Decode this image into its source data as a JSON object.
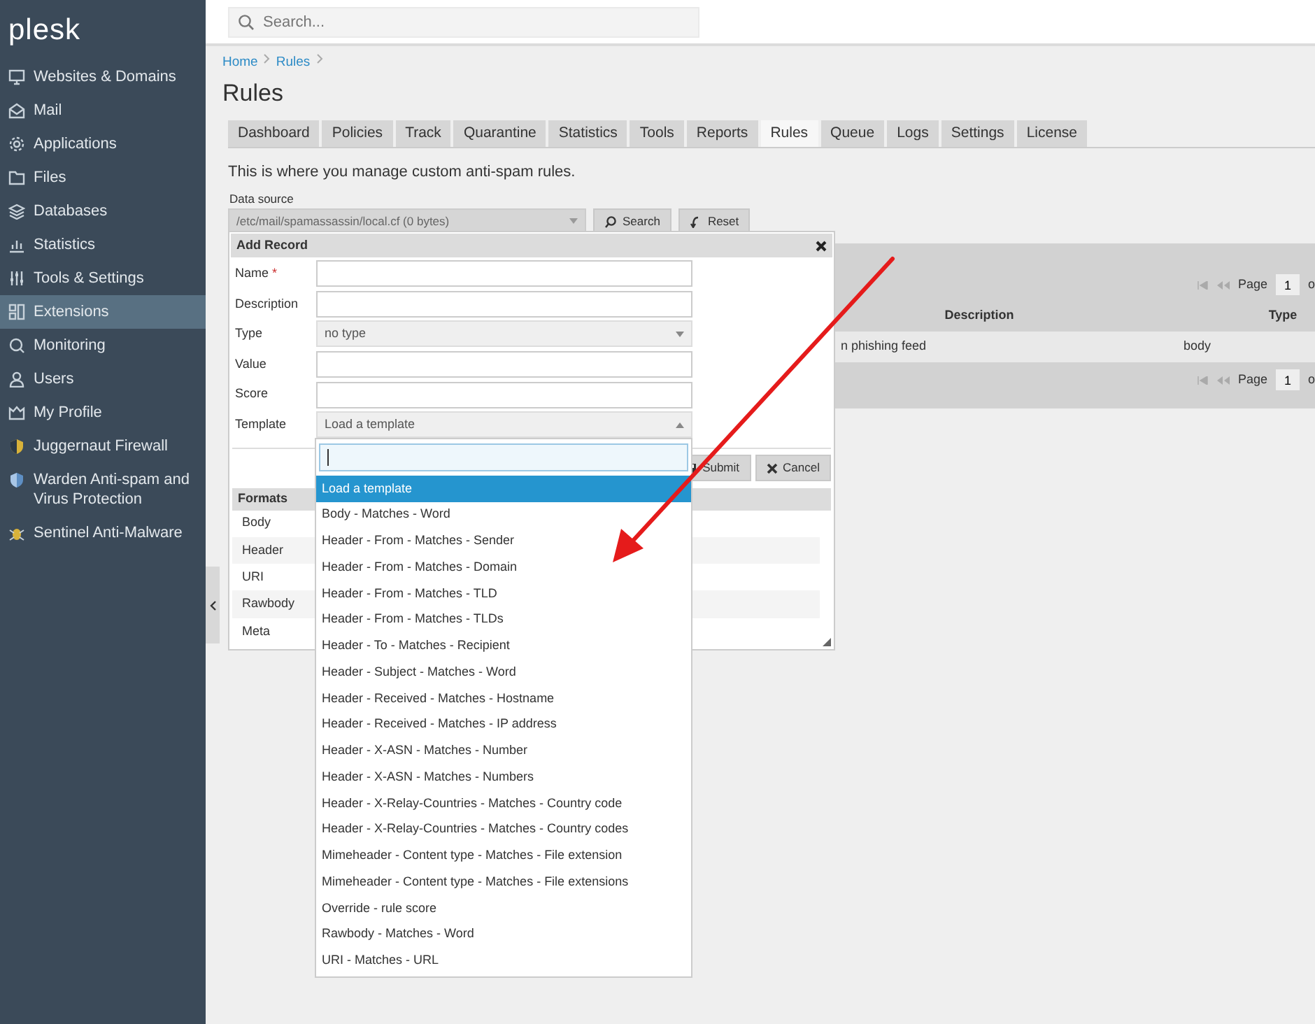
{
  "logo": "plesk",
  "sidebar": {
    "items": [
      {
        "label": "Websites & Domains",
        "selected": false
      },
      {
        "label": "Mail",
        "selected": false
      },
      {
        "label": "Applications",
        "selected": false
      },
      {
        "label": "Files",
        "selected": false
      },
      {
        "label": "Databases",
        "selected": false
      },
      {
        "label": "Statistics",
        "selected": false
      },
      {
        "label": "Tools & Settings",
        "selected": false
      },
      {
        "label": "Extensions",
        "selected": true
      },
      {
        "label": "Monitoring",
        "selected": false
      },
      {
        "label": "Users",
        "selected": false
      },
      {
        "label": "My Profile",
        "selected": false
      },
      {
        "label": "Juggernaut Firewall",
        "selected": false
      },
      {
        "label": "Warden Anti-spam and Virus Protection",
        "selected": false
      },
      {
        "label": "Sentinel Anti-Malware",
        "selected": false
      }
    ]
  },
  "search": {
    "placeholder": "Search..."
  },
  "breadcrumbs": [
    "Home",
    "Rules"
  ],
  "page_title": "Rules",
  "tabs": [
    {
      "label": "Dashboard",
      "selected": false
    },
    {
      "label": "Policies",
      "selected": false
    },
    {
      "label": "Track",
      "selected": false
    },
    {
      "label": "Quarantine",
      "selected": false
    },
    {
      "label": "Statistics",
      "selected": false
    },
    {
      "label": "Tools",
      "selected": false
    },
    {
      "label": "Reports",
      "selected": false
    },
    {
      "label": "Rules",
      "selected": true
    },
    {
      "label": "Queue",
      "selected": false
    },
    {
      "label": "Logs",
      "selected": false
    },
    {
      "label": "Settings",
      "selected": false
    },
    {
      "label": "License",
      "selected": false
    }
  ],
  "intro": "This is where you manage custom anti-spam rules.",
  "data_source": {
    "label": "Data source",
    "value": "/etc/mail/spamassassin/local.cf (0 bytes)"
  },
  "buttons": [
    "Search",
    "Reset"
  ],
  "table": {
    "pagers": [
      {
        "label": "Page",
        "page": "1",
        "suffix": "o"
      },
      {
        "label": "Page",
        "page": "1",
        "suffix": "o"
      }
    ],
    "columns": [
      "Description",
      "Type"
    ],
    "rows": [
      {
        "description": "n phishing feed",
        "type": "body"
      }
    ]
  },
  "dialog": {
    "title": "Add Record",
    "fields": [
      {
        "label": "Name",
        "required_mark": "*",
        "kind": "text"
      },
      {
        "label": "Description",
        "kind": "text"
      },
      {
        "label": "Type",
        "kind": "select",
        "value": "no type",
        "expanded": false
      },
      {
        "label": "Value",
        "kind": "text"
      },
      {
        "label": "Score",
        "kind": "text"
      },
      {
        "label": "Template",
        "kind": "select",
        "value": "Load a template",
        "expanded": true
      }
    ],
    "buttons": [
      "Submit",
      "Cancel"
    ],
    "formats": {
      "title": "Formats",
      "items": [
        "Body",
        "Header",
        "URI",
        "Rawbody",
        "Meta"
      ]
    }
  },
  "dropdown": {
    "options": [
      {
        "label": "Load a template",
        "selected": true
      },
      {
        "label": "Body - Matches - Word",
        "selected": false
      },
      {
        "label": "Header - From - Matches - Sender",
        "selected": false
      },
      {
        "label": "Header - From - Matches - Domain",
        "selected": false
      },
      {
        "label": "Header - From - Matches - TLD",
        "selected": false
      },
      {
        "label": "Header - From - Matches - TLDs",
        "selected": false
      },
      {
        "label": "Header - To - Matches - Recipient",
        "selected": false
      },
      {
        "label": "Header - Subject - Matches - Word",
        "selected": false
      },
      {
        "label": "Header - Received - Matches - Hostname",
        "selected": false
      },
      {
        "label": "Header - Received - Matches - IP address",
        "selected": false
      },
      {
        "label": "Header - X-ASN - Matches - Number",
        "selected": false
      },
      {
        "label": "Header - X-ASN - Matches - Numbers",
        "selected": false
      },
      {
        "label": "Header - X-Relay-Countries - Matches - Country code",
        "selected": false
      },
      {
        "label": "Header - X-Relay-Countries - Matches - Country codes",
        "selected": false
      },
      {
        "label": "Mimeheader - Content type - Matches - File extension",
        "selected": false
      },
      {
        "label": "Mimeheader - Content type - Matches - File extensions",
        "selected": false
      },
      {
        "label": "Override - rule score",
        "selected": false
      },
      {
        "label": "Rawbody - Matches - Word",
        "selected": false
      },
      {
        "label": "URI - Matches - URL",
        "selected": false
      }
    ]
  }
}
